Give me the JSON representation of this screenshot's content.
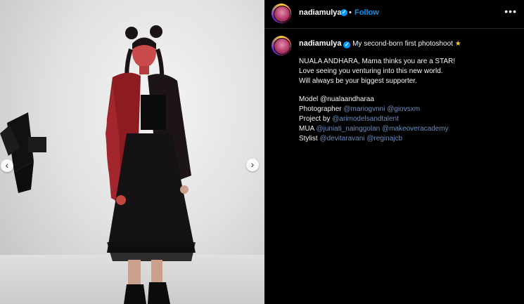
{
  "post": {
    "username": "nadiamulya",
    "follow_label": "Follow",
    "more_label": "•••",
    "caption_title": "My second-born first photoshoot",
    "caption_emoji": "★",
    "lines": [
      "NUALA ANDHARA, Mama thinks you are a STAR!",
      "Love seeing you venturing into this new world.",
      "Will always be your biggest supporter."
    ],
    "credits": {
      "model_label": "Model @nualaandharaa",
      "photographer_label": "Photographer",
      "photographer_tags": [
        "@mariogvnni",
        "@giovsxm"
      ],
      "project_label": "Project by",
      "project_tags": [
        "@arimodelsandtalent"
      ],
      "mua_label": "MUA",
      "mua_tags": [
        "@juniati_nainggolan",
        "@makeoveracademy"
      ],
      "stylist_label": "Stylist",
      "stylist_tags": [
        "@devitaravani",
        "@reginajcb"
      ]
    }
  },
  "carousel": {
    "prev_icon": "‹",
    "next_icon": "›"
  },
  "colors": {
    "link": "#0095f6",
    "mention": "#6f8fbf",
    "background": "#000000"
  }
}
